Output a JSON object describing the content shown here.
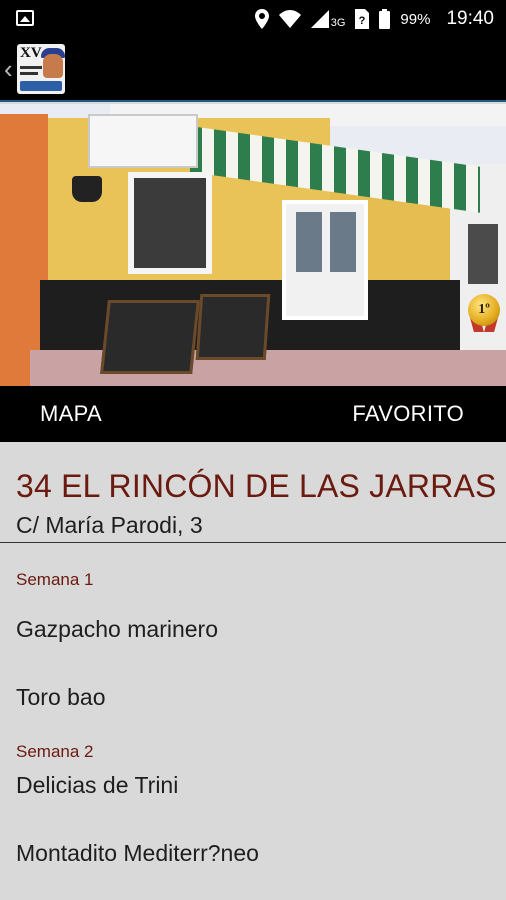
{
  "status_bar": {
    "battery_percent": "99%",
    "network_type": "3G",
    "time": "19:40",
    "icons": [
      "image-icon",
      "location-icon",
      "wifi-icon",
      "signal-icon",
      "sim-icon",
      "battery-icon"
    ]
  },
  "app_bar": {
    "back_glyph": "‹",
    "logo_text": "XV"
  },
  "photo": {
    "medal_label": "1º"
  },
  "actions": {
    "map_label": "MAPA",
    "favorite_label": "FAVORITO"
  },
  "venue": {
    "title": "34 EL RINCÓN DE LAS JARRAS",
    "address": "C/ María Parodi, 3"
  },
  "menu": {
    "weeks": [
      {
        "label": "Semana 1",
        "dishes": [
          "Gazpacho marinero",
          "Toro bao"
        ]
      },
      {
        "label": "Semana 2",
        "dishes": [
          "Delicias de Trini",
          "Montadito Mediterr?neo"
        ]
      }
    ]
  },
  "colors": {
    "title_color": "#6a1a0f",
    "bar_background": "#000000",
    "content_background": "#d9d9d9"
  }
}
